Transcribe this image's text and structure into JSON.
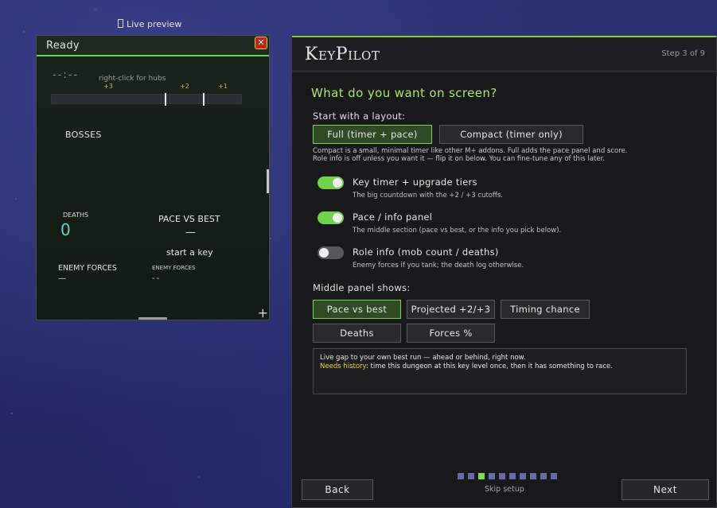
{
  "live_preview": {
    "label": "Live preview"
  },
  "preview": {
    "title": "Ready",
    "close_glyph": "✕",
    "timer": "--:--",
    "hubs_hint": "right-click for hubs",
    "ticks": [
      "+3",
      "+2",
      "+1"
    ],
    "bosses_label": "BOSSES",
    "deaths_label": "DEATHS",
    "deaths_value": "0",
    "pace_label": "PACE VS BEST",
    "pace_value": "—",
    "start_key": "start a key",
    "enemy_forces_label": "ENEMY FORCES",
    "enemy_forces_value": "—",
    "enemy_forces_small_label": "ENEMY FORCES",
    "enemy_forces_small_value": "--",
    "plus_glyph": "+"
  },
  "wizard": {
    "logo": "KeyPilot",
    "step": "Step 3 of 9",
    "question": "What do you want on screen?",
    "layout_label": "Start with a layout:",
    "layouts": [
      {
        "label": "Full  (timer + pace)",
        "selected": true
      },
      {
        "label": "Compact  (timer only)",
        "selected": false
      }
    ],
    "layout_note_1": "Compact is a small, minimal timer like other M+ addons. Full adds the pace panel and score.",
    "layout_note_2": "Role info is off unless you want it — flip it on below. You can fine-tune any of this later.",
    "options": [
      {
        "title": "Key timer + upgrade tiers",
        "desc": "The big countdown with the +2 / +3 cutoffs.",
        "on": true
      },
      {
        "title": "Pace / info panel",
        "desc": "The middle section (pace vs best, or the info you pick below).",
        "on": true
      },
      {
        "title": "Role info (mob count / deaths)",
        "desc": "Enemy forces if you tank; the death log otherwise.",
        "on": false
      }
    ],
    "middle_label": "Middle panel shows:",
    "middle_options": [
      {
        "label": "Pace vs best",
        "selected": true
      },
      {
        "label": "Projected +2/+3",
        "selected": false
      },
      {
        "label": "Timing chance",
        "selected": false
      },
      {
        "label": "Deaths",
        "selected": false
      },
      {
        "label": "Forces %",
        "selected": false
      }
    ],
    "info_line_1": "Live gap to your own best run — ahead or behind, right now.",
    "info_highlight": "Needs history",
    "info_line_2_rest": ": time this dungeon at this key level once, then it has something to race.",
    "progress": {
      "total": 10,
      "current": 3
    },
    "skip": "Skip setup",
    "back": "Back",
    "next": "Next"
  },
  "colors": {
    "accent": "#6fd24a",
    "title": "#a7e86a",
    "highlight": "#f2d13a",
    "deaths": "#5fd8c8"
  }
}
